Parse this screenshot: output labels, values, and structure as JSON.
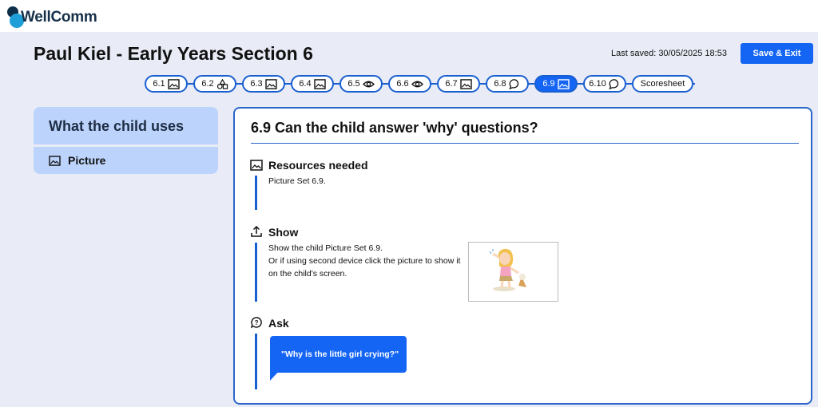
{
  "app": {
    "logo_text": "WellComm"
  },
  "header": {
    "title": "Paul Kiel - Early Years Section 6",
    "last_saved": "Last saved: 30/05/2025 18:53",
    "save_label": "Save & Exit"
  },
  "steps": [
    {
      "label": "6.1",
      "icon": "image-icon",
      "active": false
    },
    {
      "label": "6.2",
      "icon": "shapes-icon",
      "active": false
    },
    {
      "label": "6.3",
      "icon": "image-icon",
      "active": false
    },
    {
      "label": "6.4",
      "icon": "image-icon",
      "active": false
    },
    {
      "label": "6.5",
      "icon": "eye-icon",
      "active": false
    },
    {
      "label": "6.6",
      "icon": "eye-icon",
      "active": false
    },
    {
      "label": "6.7",
      "icon": "image-icon",
      "active": false
    },
    {
      "label": "6.8",
      "icon": "speech-bubble-icon",
      "active": false
    },
    {
      "label": "6.9",
      "icon": "image-icon",
      "active": true
    },
    {
      "label": "6.10",
      "icon": "speech-bubble-icon",
      "active": false
    },
    {
      "label": "Scoresheet",
      "icon": "",
      "active": false
    }
  ],
  "sidebar": {
    "heading": "What the child uses",
    "items": [
      {
        "label": "Picture",
        "icon": "image-icon"
      }
    ]
  },
  "main": {
    "title": "6.9 Can the child answer 'why' questions?",
    "resources": {
      "heading": "Resources needed",
      "icon": "image-icon",
      "text": "Picture Set 6.9."
    },
    "show": {
      "heading": "Show",
      "icon": "upload-icon",
      "lines": [
        "Show the child Picture Set 6.9.",
        "Or if using second device click the picture to show it",
        "on the child's screen."
      ],
      "picture": "crying-girl-with-dropped-ice-cream-illustration"
    },
    "ask": {
      "heading": "Ask",
      "icon": "question-bubble-icon",
      "bubble_text": "\"Why is the little girl crying?\""
    }
  },
  "colors": {
    "accent": "#1565f5",
    "border": "#2a66c8",
    "sidebar": "#bcd3fb",
    "background": "#e9ecf6"
  }
}
